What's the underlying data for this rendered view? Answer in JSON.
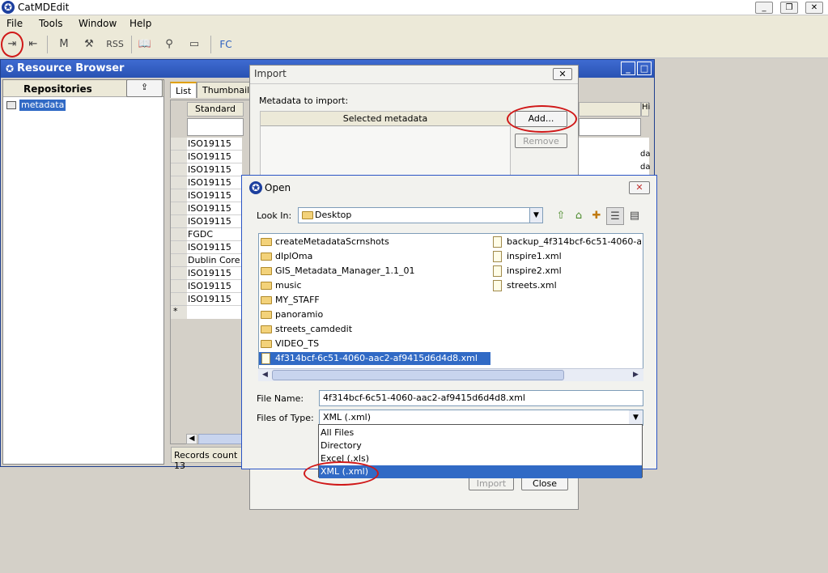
{
  "app": {
    "title": "CatMDEdit"
  },
  "menu": [
    "File",
    "Tools",
    "Window",
    "Help"
  ],
  "toolbar": {
    "rss": "RSS",
    "fc": "FC"
  },
  "resource_browser": {
    "title": "Resource Browser",
    "repositories_label": "Repositories",
    "tree_item": "metadata",
    "tabs": [
      "List",
      "Thumbnails"
    ],
    "column_standard": "Standard",
    "column_hi": "Hi",
    "rows": [
      "ISO19115",
      "ISO19115",
      "ISO19115",
      "ISO19115",
      "ISO19115",
      "ISO19115",
      "ISO19115",
      "FGDC",
      "ISO19115",
      "Dublin Core",
      "ISO19115",
      "ISO19115",
      "ISO19115"
    ],
    "new_row_marker": "*",
    "records_count": "Records count 13",
    "right_values": [
      "da",
      "da"
    ]
  },
  "import_dialog": {
    "title": "Import",
    "metadata_label": "Metadata to import:",
    "column_selected": "Selected metadata",
    "add_button": "Add...",
    "remove_button": "Remove",
    "import_button": "Import",
    "close_button": "Close"
  },
  "open_dialog": {
    "title": "Open",
    "look_in_label": "Look In:",
    "look_in_value": "Desktop",
    "folders": [
      "createMetadataScrnshots",
      "dIplOma",
      "GIS_Metadata_Manager_1.1_01",
      "music",
      "MY_STAFF",
      "panoramio",
      "streets_camdedit",
      "VIDEO_TS"
    ],
    "selected_file": "4f314bcf-6c51-4060-aac2-af9415d6d4d8.xml",
    "files": [
      "backup_4f314bcf-6c51-4060-aac2-a",
      "inspire1.xml",
      "inspire2.xml",
      "streets.xml"
    ],
    "file_name_label": "File Name:",
    "file_name_value": "4f314bcf-6c51-4060-aac2-af9415d6d4d8.xml",
    "files_of_type_label": "Files of Type:",
    "files_of_type_value": "XML (.xml)",
    "type_options": [
      "All Files",
      "Directory",
      "Excel (.xls)",
      "XML (.xml)"
    ]
  },
  "colors": {
    "title_blue": "#2952b3",
    "selection": "#316ac5",
    "annotation_red": "#d01818"
  }
}
